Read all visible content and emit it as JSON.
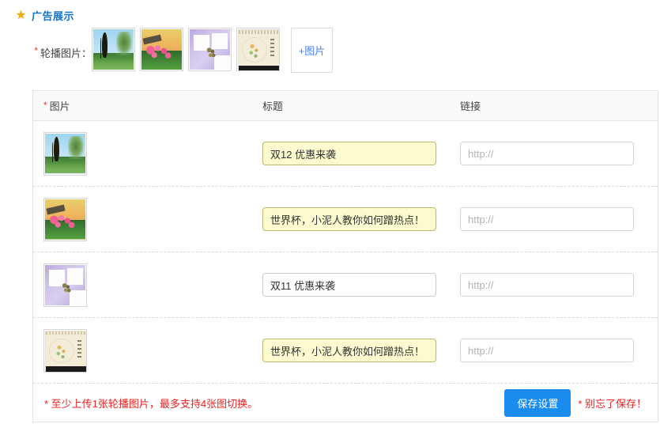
{
  "section": {
    "icon": "star-icon",
    "title": "广告展示"
  },
  "upload": {
    "required_marker": "*",
    "label": "轮播图片：",
    "add_button_label": "+图片",
    "thumbnails": [
      {
        "alt": "tree-landscape-thumbnail"
      },
      {
        "alt": "pink-flowers-sunset-thumbnail"
      },
      {
        "alt": "purple-photo-frame-thumbnail"
      },
      {
        "alt": "beige-floral-card-thumbnail"
      }
    ]
  },
  "table": {
    "headers": {
      "image_marker": "*",
      "image": "图片",
      "title": "标题",
      "link": "链接"
    },
    "link_placeholder": "http://",
    "rows": [
      {
        "thumb_alt": "tree-landscape-thumbnail",
        "title_value": "双12 优惠来袭",
        "title_highlighted": true,
        "link_value": ""
      },
      {
        "thumb_alt": "pink-flowers-sunset-thumbnail",
        "title_value": "世界杯，小泥人教你如何蹭热点！",
        "title_highlighted": true,
        "link_value": ""
      },
      {
        "thumb_alt": "purple-photo-frame-thumbnail",
        "title_value": "双11 优惠来袭",
        "title_highlighted": false,
        "link_value": ""
      },
      {
        "thumb_alt": "beige-floral-card-thumbnail",
        "title_value": "世界杯，小泥人教你如何蹭热点！",
        "title_highlighted": true,
        "link_value": ""
      }
    ]
  },
  "footer": {
    "note": "* 至少上传1张轮播图片，最多支持4张图切换。",
    "save_label": "保存设置",
    "save_note": "* 别忘了保存！"
  },
  "colors": {
    "star": "#f0a90d",
    "title_blue": "#1673c9",
    "required_red": "#e83b2f",
    "note_red": "#ee2222",
    "button_blue": "#1a8cee",
    "highlight_yellow": "#fbfbcf",
    "link_blue": "#4a7ff5"
  }
}
